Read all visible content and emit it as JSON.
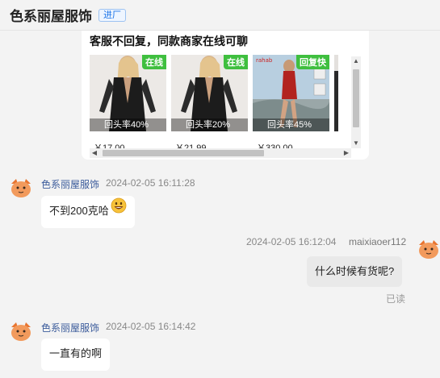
{
  "header": {
    "title": "色系丽屋服饰",
    "tag": "进厂"
  },
  "recommendation": {
    "title": "客服不回复，同款商家在线可聊",
    "items": [
      {
        "status": "在线",
        "repeat_rate": "回头率40%",
        "price": "￥17.00"
      },
      {
        "status": "在线",
        "repeat_rate": "回头率20%",
        "price": "￥21.99"
      },
      {
        "status": "回复快",
        "repeat_rate": "回头率45%",
        "price": "￥330.00"
      }
    ]
  },
  "messages": [
    {
      "sender": "色系丽屋服饰",
      "time": "2024-02-05 16:11:28",
      "text": "不到200克哈",
      "emoji": "grinning-face-icon"
    },
    {
      "sender": "maixiaoer112",
      "time": "2024-02-05 16:12:04",
      "text": "什么时候有货呢?",
      "status": "已读"
    },
    {
      "sender": "色系丽屋服饰",
      "time": "2024-02-05 16:14:42",
      "text": "一直有的啊"
    }
  ],
  "colors": {
    "online_tag": "#3fbf3f",
    "sender_name": "#3b5b9b",
    "tag_blue": "#1a73e8",
    "avatar": "#f29a5c"
  }
}
